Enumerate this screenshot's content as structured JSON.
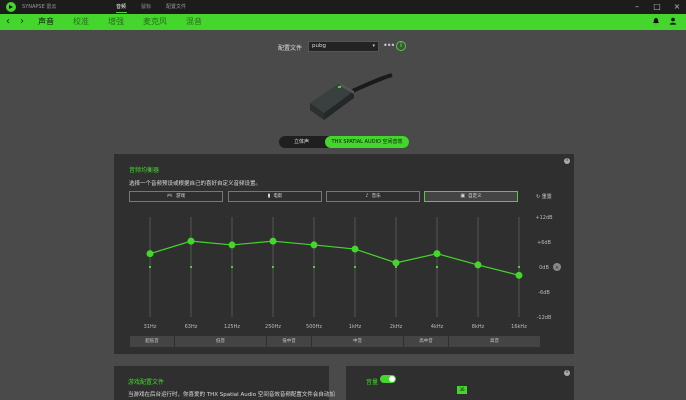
{
  "titlebar": {
    "app": "SYNAPSE 雷云",
    "tabs": [
      "音频",
      "鼠标",
      "配置文件"
    ],
    "active_tab": "音频"
  },
  "nav": {
    "tabs": [
      "声音",
      "校准",
      "增强",
      "麦克风",
      "混音"
    ],
    "active_tab": "声音"
  },
  "profile": {
    "label": "配置文件",
    "value": "pubg",
    "more": "•••",
    "info": "i"
  },
  "mode": {
    "stereo": "立体声",
    "thx": "THX SPATIAL AUDIO 空间音效",
    "active": "THX SPATIAL AUDIO 空间音效"
  },
  "eq": {
    "title": "音频均衡器",
    "description": "选择一个音频预设或根据自己的喜好自定义音频设置。",
    "presets": [
      {
        "label": "游戏",
        "icon": "gamepad-icon",
        "glyph": "🎮"
      },
      {
        "label": "电影",
        "icon": "film-icon",
        "glyph": "▮"
      },
      {
        "label": "音乐",
        "icon": "music-note-icon",
        "glyph": "♪"
      },
      {
        "label": "自定义",
        "icon": "custom-icon",
        "glyph": "▣"
      }
    ],
    "active_preset": "自定义",
    "reset": "重置",
    "db_labels": [
      "+12dB",
      "+6dB",
      "0dB",
      "-6dB",
      "-12dB"
    ],
    "ranges": [
      {
        "label": "超低音",
        "span": 1
      },
      {
        "label": "低音",
        "span": 2
      },
      {
        "label": "低中音",
        "span": 1
      },
      {
        "label": "中音",
        "span": 2
      },
      {
        "label": "高中音",
        "span": 1
      },
      {
        "label": "高音",
        "span": 2
      }
    ]
  },
  "chart_data": {
    "type": "line",
    "title": "音频均衡器",
    "x": [
      "31Hz",
      "63Hz",
      "125Hz",
      "250Hz",
      "500Hz",
      "1kHz",
      "2kHz",
      "4kHz",
      "8kHz",
      "16kHz"
    ],
    "series": [
      {
        "values": [
          3.2,
          6.2,
          5.3,
          6.2,
          5.3,
          4.3,
          1.0,
          3.2,
          0.5,
          -2.0
        ]
      }
    ],
    "ylim": [
      -12,
      12
    ],
    "yticks": [
      "+12dB",
      "+6dB",
      "0dB",
      "-6dB",
      "-12dB"
    ],
    "grid": false
  },
  "game_profile": {
    "title": "游戏配置文件",
    "description": "当游戏在后台运行时，你喜爱的 THX Spatial Audio 空间音效音频配置文件会自动加"
  },
  "volume": {
    "title": "音量",
    "enabled": true,
    "value": "36"
  },
  "colors": {
    "accent": "#44d62c",
    "panel": "#2f2f2f",
    "background": "#4a4a4a"
  }
}
